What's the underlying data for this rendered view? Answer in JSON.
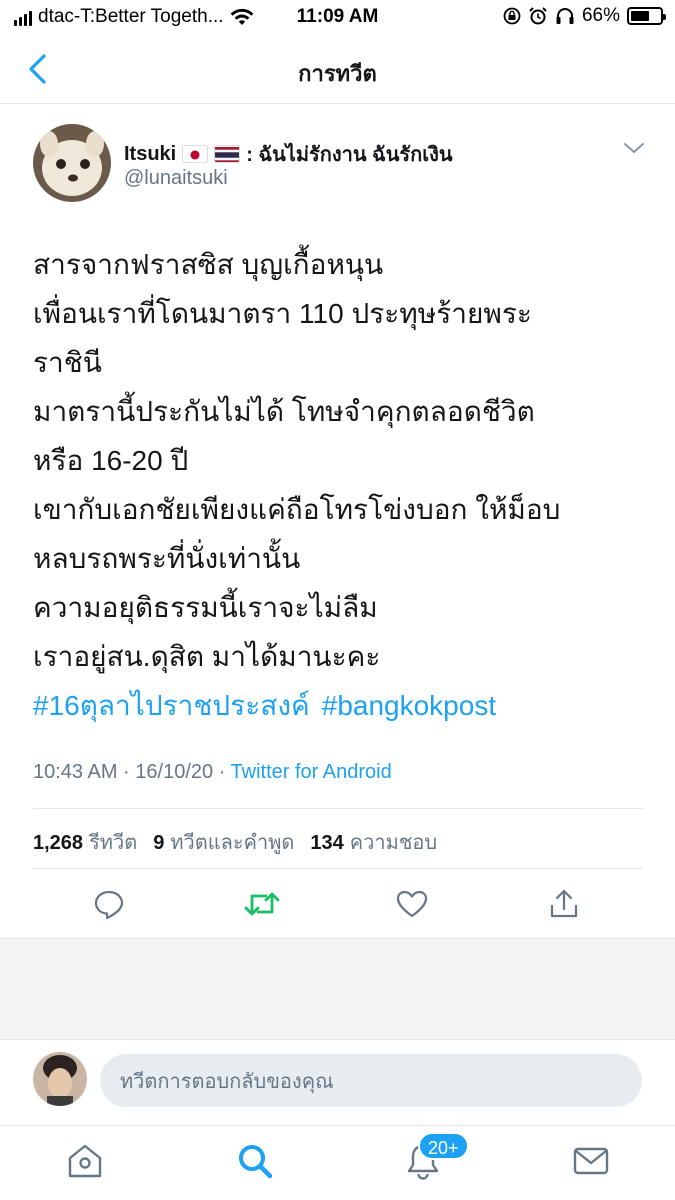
{
  "status_bar": {
    "carrier": "dtac-T:Better Togeth...",
    "time": "11:09 AM",
    "battery_percent": "66%",
    "battery_level": 0.66
  },
  "header": {
    "title": "การทวีต",
    "back_icon": "chevron-left-icon"
  },
  "tweet": {
    "author": {
      "name": "Itsuki",
      "name_suffix": ": ฉันไม่รักงาน ฉันรักเงิน",
      "flags": [
        "japan-flag",
        "thailand-flag"
      ],
      "handle": "@lunaitsuki"
    },
    "lines": [
      "สารจากฟราสซิส บุญเกื้อหนุน",
      "เพื่อนเราที่โดนมาตรา 110 ประทุษร้ายพระ",
      "ราชินี",
      "มาตรานี้ประกันไม่ได้ โทษจำคุกตลอดชีวิต",
      "หรือ 16-20 ปี",
      "เขากับเอกชัยเพียงแค่ถือโทรโข่งบอก ให้ม็อบ",
      "หลบรถพระที่นั่งเท่านั้น",
      "ความอยุติธรรมนี้เราจะไม่ลืม",
      "เราอยู่สน.ดุสิต มาได้มานะคะ"
    ],
    "hashtags": [
      "#16ตุลาไปราชประสงค์",
      "#bangkokpost"
    ],
    "timestamp": "10:43 AM · 16/10/20 · ",
    "source": "Twitter for Android",
    "stats": {
      "retweets_count": "1,268",
      "retweets_label": "รีทวีต",
      "quotes_count": "9",
      "quotes_label": "ทวีตและคำพูด",
      "likes_count": "134",
      "likes_label": "ความชอบ"
    },
    "actions": [
      "reply-icon",
      "retweet-icon",
      "like-icon",
      "share-icon"
    ]
  },
  "reply": {
    "placeholder": "ทวีตการตอบกลับของคุณ"
  },
  "tabbar": {
    "items": [
      "home-icon",
      "search-icon",
      "notifications-icon",
      "messages-icon"
    ],
    "notifications_badge": "20+"
  },
  "colors": {
    "accent": "#1da1f2",
    "retweet": "#17bf63",
    "muted": "#657786",
    "text": "#14171a"
  }
}
